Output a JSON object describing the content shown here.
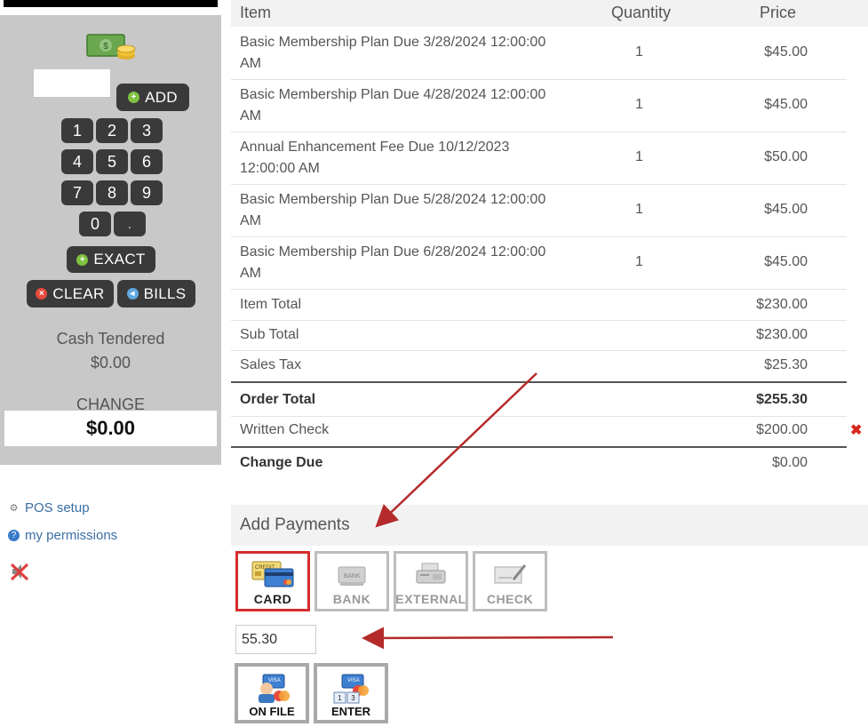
{
  "pos": {
    "add_label": "ADD",
    "keys": [
      "1",
      "2",
      "3",
      "4",
      "5",
      "6",
      "7",
      "8",
      "9",
      "0",
      "."
    ],
    "exact_label": "EXACT",
    "clear_label": "CLEAR",
    "bills_label": "BILLS",
    "cash_tendered_label": "Cash Tendered",
    "cash_tendered_value": "$0.00",
    "change_label": "CHANGE",
    "change_value": "$0.00",
    "amount_value": ""
  },
  "sidebar": {
    "pos_setup": "POS setup",
    "my_permissions": "my permissions"
  },
  "table": {
    "headers": {
      "item": "Item",
      "quantity": "Quantity",
      "price": "Price"
    },
    "rows": [
      {
        "item_line1": "Basic Membership Plan Due 3/28/2024 12:00:00",
        "item_line2": "AM",
        "qty": "1",
        "price": "$45.00"
      },
      {
        "item_line1": "Basic Membership Plan Due 4/28/2024 12:00:00",
        "item_line2": "AM",
        "qty": "1",
        "price": "$45.00"
      },
      {
        "item_line1": "Annual Enhancement Fee Due 10/12/2023",
        "item_line2": "12:00:00 AM",
        "qty": "1",
        "price": "$50.00"
      },
      {
        "item_line1": "Basic Membership Plan Due 5/28/2024 12:00:00",
        "item_line2": "AM",
        "qty": "1",
        "price": "$45.00"
      },
      {
        "item_line1": "Basic Membership Plan Due 6/28/2024 12:00:00",
        "item_line2": "AM",
        "qty": "1",
        "price": "$45.00"
      }
    ],
    "totals": {
      "item_total_label": "Item Total",
      "item_total": "$230.00",
      "sub_total_label": "Sub Total",
      "sub_total": "$230.00",
      "sales_tax_label": "Sales Tax",
      "sales_tax": "$25.30",
      "order_total_label": "Order Total",
      "order_total": "$255.30",
      "written_check_label": "Written Check",
      "written_check": "$200.00",
      "change_due_label": "Change Due",
      "change_due": "$0.00"
    }
  },
  "payments": {
    "heading": "Add Payments",
    "methods": [
      {
        "label": "CARD",
        "selected": true
      },
      {
        "label": "BANK",
        "selected": false
      },
      {
        "label": "EXTERNAL",
        "selected": false
      },
      {
        "label": "CHECK",
        "selected": false
      }
    ],
    "amount_value": "55.30",
    "card_options": [
      {
        "label": "ON FILE"
      },
      {
        "label": "ENTER"
      }
    ]
  },
  "colors": {
    "panel_bg": "#c8c8c8",
    "button_bg": "#3a3a3a",
    "link": "#3a6ea5",
    "selected_border": "#d62d2d",
    "annotation_arrow": "#b52a2a"
  }
}
